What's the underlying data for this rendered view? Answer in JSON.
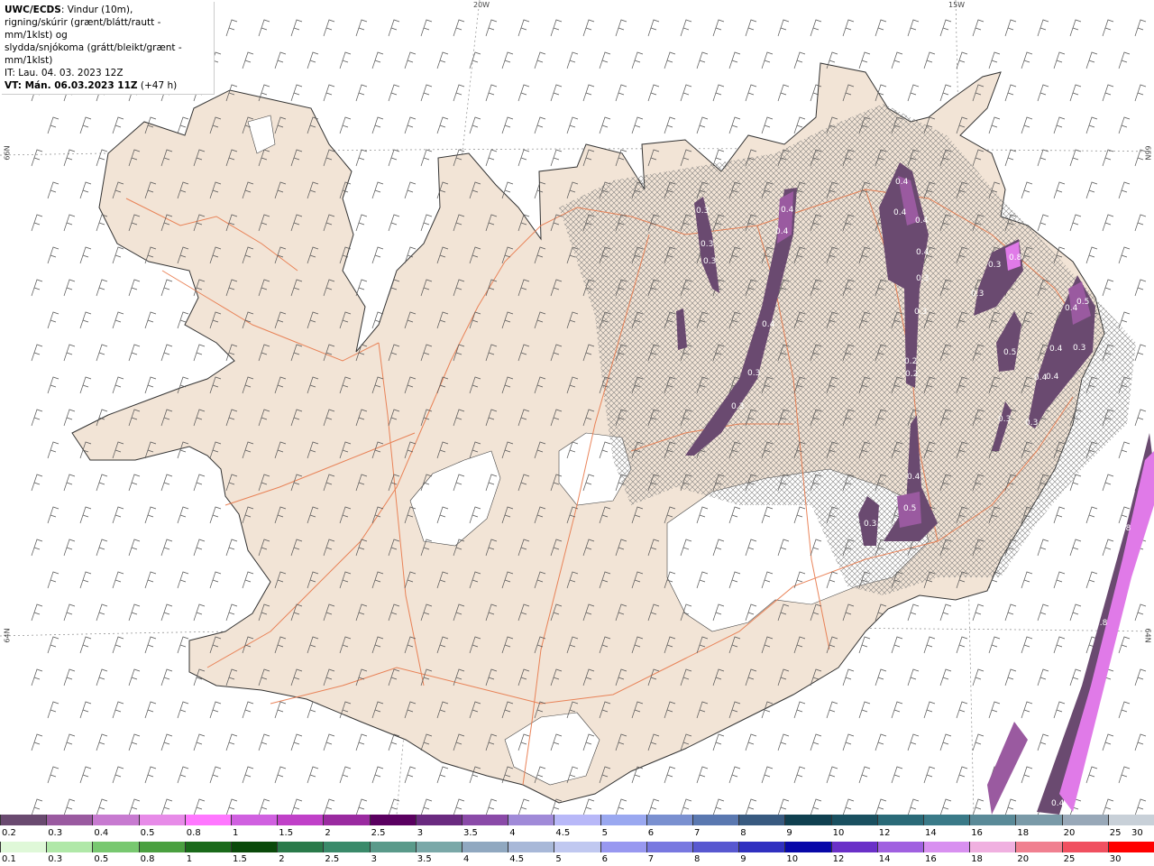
{
  "header": {
    "product": "UWC/ECDS",
    "line1_rest": ": Vindur (10m),",
    "line2": "rigning/skúrir (grænt/blátt/rautt - mm/1klst) og",
    "line3": "slydda/snjókoma (grátt/bleikt/grænt - mm/1klst)",
    "issue_time": "IT: Lau. 04. 03. 2023 12Z",
    "valid_label": "VT: Mán. 06.03.2023 11Z",
    "valid_offset": " (+47 h)"
  },
  "grid_labels": {
    "lon_20w": "20W",
    "lon_15w": "15W",
    "lat_66n_left": "66N",
    "lat_66n_right": "66N",
    "lat_64n_left": "64N",
    "lat_64n_right": "64N"
  },
  "snow_colorbar": {
    "labels": [
      "0.2",
      "0.3",
      "0.4",
      "0.5",
      "0.8",
      "1",
      "1.5",
      "2",
      "2.5",
      "3",
      "3.5",
      "4",
      "4.5",
      "5",
      "6",
      "7",
      "8",
      "9",
      "10",
      "12",
      "14",
      "16",
      "18",
      "20",
      "25",
      "30"
    ],
    "colors": [
      "#6a4a70",
      "#9a5aa0",
      "#c77ad0",
      "#e78be8",
      "#ff77ff",
      "#d060e0",
      "#c040c8",
      "#9a2aa0",
      "#5a0060",
      "#6a2a80",
      "#8a4aa8",
      "#a08ad8",
      "#b8b8f8",
      "#9aa8f0",
      "#7a90d0",
      "#5a78b0",
      "#385a80",
      "#104050",
      "#1a5060",
      "#2a6a78",
      "#3a7a88",
      "#5a8a98",
      "#7a9aa8",
      "#98a8b8",
      "#c8d0d8"
    ]
  },
  "rain_colorbar": {
    "labels": [
      "0.1",
      "0.3",
      "0.5",
      "0.8",
      "1",
      "1.5",
      "2",
      "2.5",
      "3",
      "3.5",
      "4",
      "4.5",
      "5",
      "6",
      "7",
      "8",
      "9",
      "10",
      "12",
      "14",
      "16",
      "18",
      "20",
      "25",
      "30"
    ],
    "colors": [
      "#dff8d8",
      "#b0e8a8",
      "#78c870",
      "#4aa040",
      "#1a6a1a",
      "#0a4a0a",
      "#2a7a4a",
      "#3a8a6a",
      "#5a9a8a",
      "#7aa8a8",
      "#90a8c0",
      "#a8b8d8",
      "#c0c8f0",
      "#9898f0",
      "#7878e0",
      "#5858d0",
      "#3030c0",
      "#0808a8",
      "#6a30c8",
      "#a060e0",
      "#d890f0",
      "#f0b0e0",
      "#f08090",
      "#f05060",
      "#ff0000"
    ]
  },
  "map_labels": [
    "0.3",
    "0.3",
    "0.3",
    "0.4",
    "0.4",
    "0.4",
    "0.3",
    "0.3",
    "0.4",
    "0.4",
    "0.4",
    "0.4",
    "0.3",
    "0.3",
    "0.2",
    "0.2",
    "0.4",
    "0.5",
    "0.3",
    "0.3",
    "0.8",
    "0.3",
    "0.4",
    "0.5",
    "0.4",
    "0.3",
    "0.4",
    "0.4",
    "0.5",
    "0.3",
    "0.3",
    "0.8",
    "0.8",
    "0.4"
  ],
  "colors": {
    "land": "#f2e4d6",
    "road": "#e8784a",
    "coast": "#444444",
    "precip_light": "#6a4a70",
    "precip_mid": "#9a5aa0",
    "precip_high": "#e07ae8"
  }
}
